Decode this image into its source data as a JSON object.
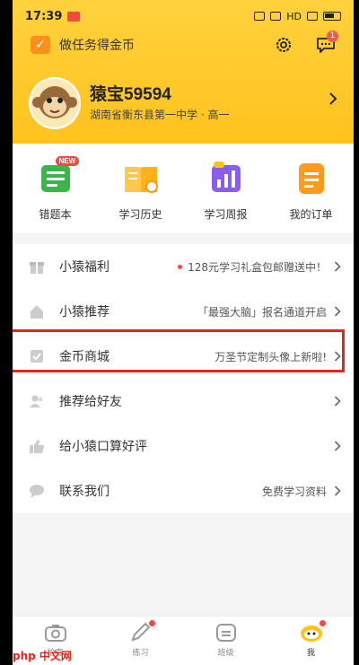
{
  "status_bar": {
    "time": "17:39",
    "right_text": "HD"
  },
  "header": {
    "task_label": "做任务得金币",
    "message_badge": "1",
    "username": "猿宝59594",
    "school": "湖南省衡东县第一中学 · 高一"
  },
  "shortcuts": [
    {
      "label": "错题本",
      "icon": "wrong-notebook-icon",
      "badge": "NEW"
    },
    {
      "label": "学习历史",
      "icon": "study-history-icon"
    },
    {
      "label": "学习周报",
      "icon": "weekly-report-icon"
    },
    {
      "label": "我的订单",
      "icon": "orders-icon"
    }
  ],
  "menu": [
    {
      "label": "小猿福利",
      "right": "128元学习礼盒包邮赠送中！",
      "icon": "gift-icon",
      "dot": true
    },
    {
      "label": "小猿推荐",
      "right": "「最强大脑」报名通道开启",
      "icon": "home-icon"
    },
    {
      "label": "金币商城",
      "right": "万圣节定制头像上新啦!",
      "icon": "shop-icon"
    },
    {
      "label": "推荐给好友",
      "right": "",
      "icon": "users-icon"
    },
    {
      "label": "给小猿口算好评",
      "right": "",
      "icon": "thumbs-up-icon"
    },
    {
      "label": "联系我们",
      "right": "免费学习资料",
      "icon": "chat-icon"
    }
  ],
  "tabbar": [
    {
      "label": "检查",
      "icon": "camera-icon"
    },
    {
      "label": "练习",
      "icon": "pencil-icon"
    },
    {
      "label": "班级",
      "icon": "class-icon"
    },
    {
      "label": "我",
      "icon": "profile-icon",
      "active": true
    }
  ],
  "watermark": "php 中文网",
  "colors": {
    "header_yellow": "#ffc21d",
    "accent_red": "#e8231b",
    "badge_red": "#f04a3a"
  }
}
